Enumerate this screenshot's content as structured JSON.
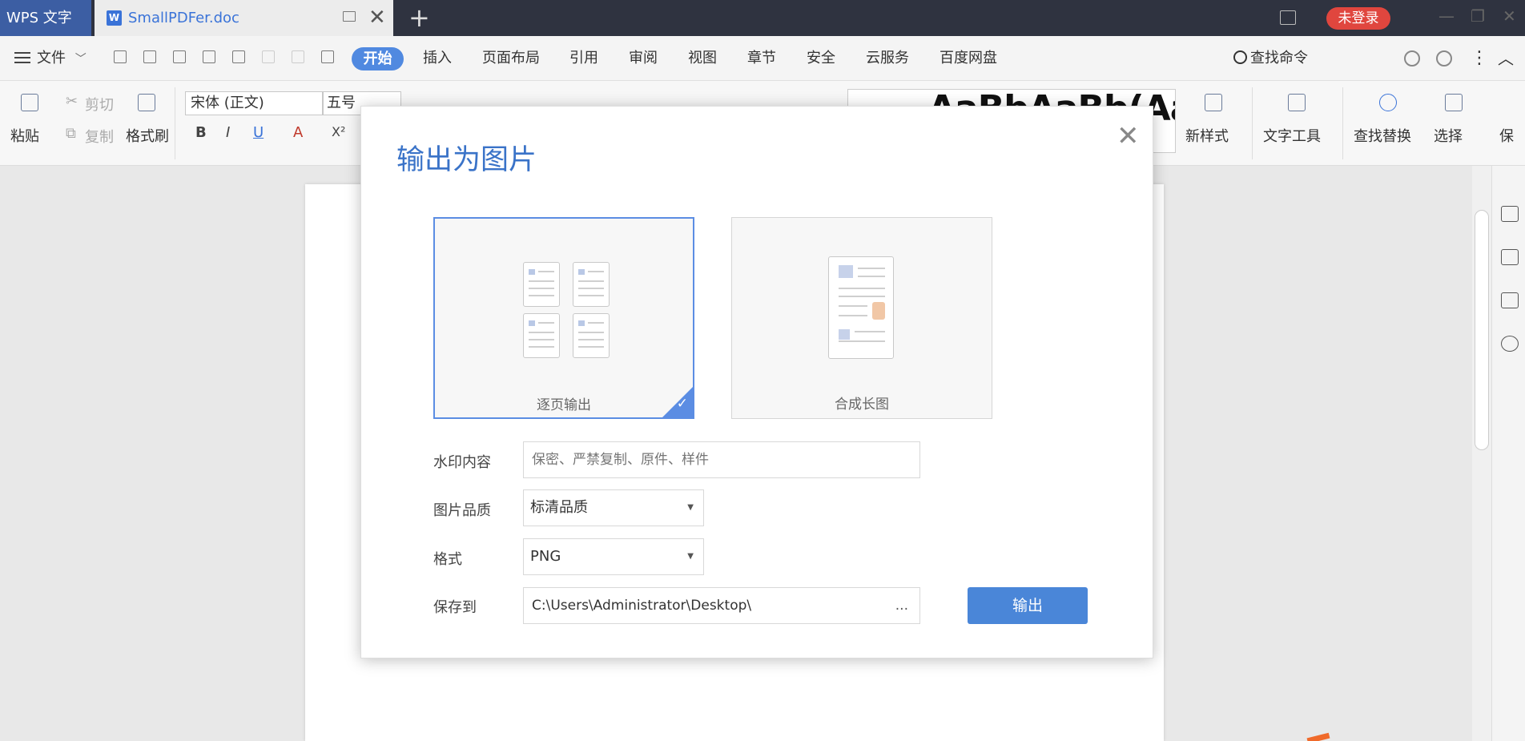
{
  "titlebar": {
    "app_label": "WPS 文字",
    "doc_tab": "SmallPDFer.doc",
    "doc_icon_letter": "W",
    "login_label": "未登录"
  },
  "menubar": {
    "file_label": "文件",
    "active_tab": "开始",
    "items": [
      "插入",
      "页面布局",
      "引用",
      "审阅",
      "视图",
      "章节",
      "安全",
      "云服务",
      "百度网盘"
    ],
    "search_label": "查找命令"
  },
  "ribbon": {
    "paste": "粘贴",
    "cut": "剪切",
    "copy": "复制",
    "format_painter": "格式刷",
    "font_name": "宋体 (正文)",
    "font_size": "五号",
    "bold": "B",
    "italic": "I",
    "underline": "U",
    "font_color": "A",
    "superscript": "X²",
    "styles_preview": "AaBbAaBb(AaBbC",
    "new_style": "新样式",
    "text_tools": "文字工具",
    "find_replace": "查找替换",
    "select": "选择",
    "save_cut": "保"
  },
  "dialog": {
    "title": "输出为图片",
    "option_per_page": "逐页输出",
    "option_long_image": "合成长图",
    "watermark_label": "水印内容",
    "watermark_placeholder": "保密、严禁复制、原件、样件",
    "quality_label": "图片品质",
    "quality_value": "标清品质",
    "format_label": "格式",
    "format_value": "PNG",
    "save_label": "保存到",
    "save_path": "C:\\Users\\Administrator\\Desktop\\",
    "browse_label": "...",
    "export_button": "输出",
    "selected_option": "逐页输出"
  },
  "colors": {
    "accent": "#4a86d8",
    "title_blue": "#3a73c8",
    "login_red": "#e0463e",
    "titlebar_bg": "#2f3340"
  }
}
